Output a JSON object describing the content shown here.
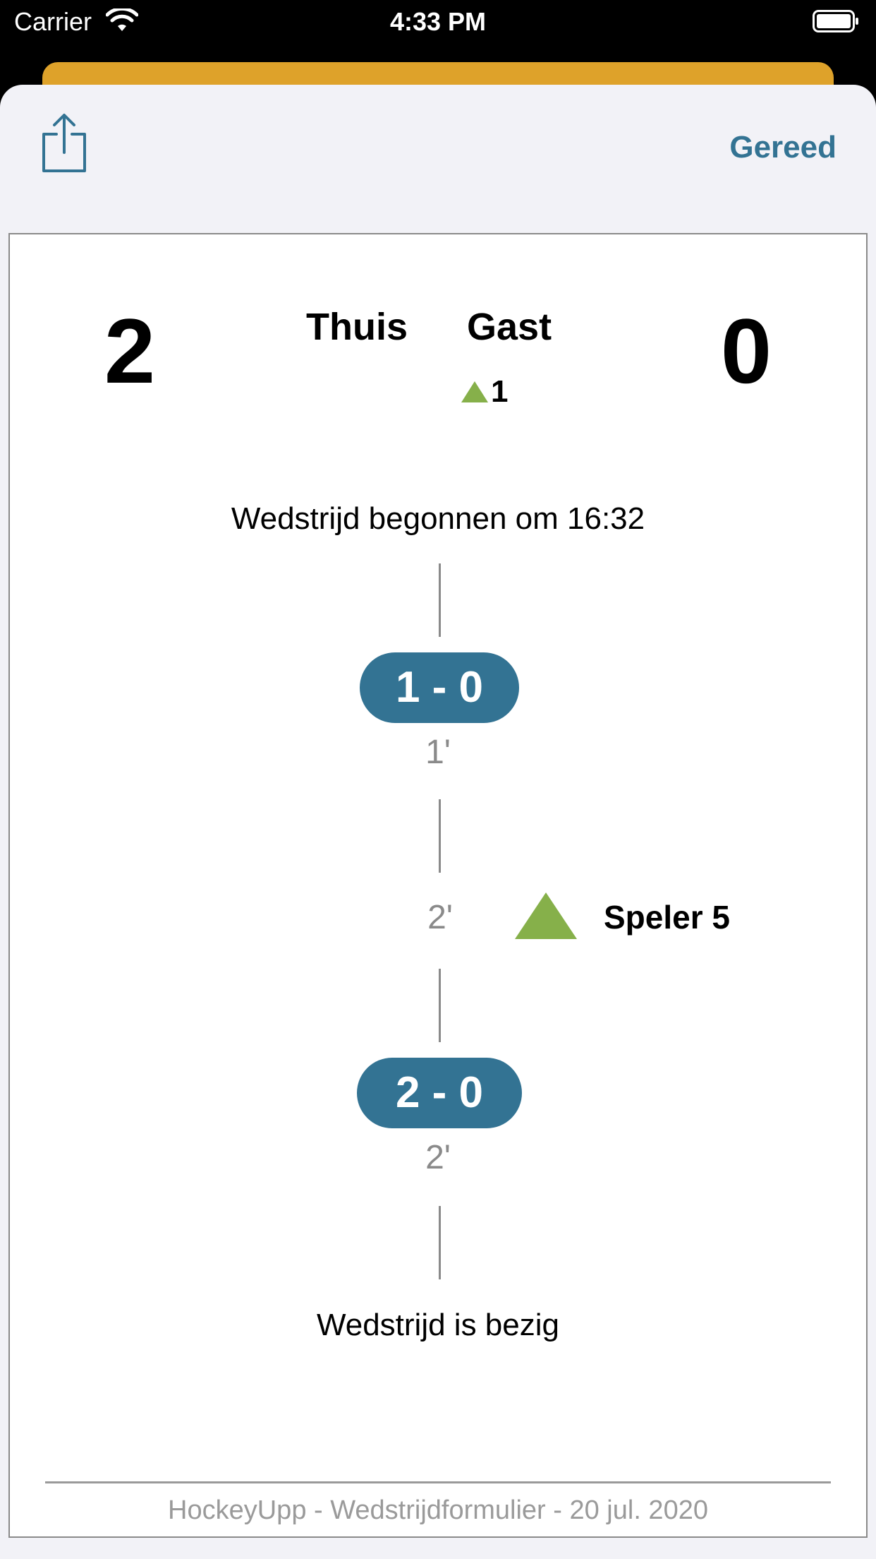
{
  "status_bar": {
    "carrier": "Carrier",
    "time": "4:33 PM"
  },
  "toolbar": {
    "done_label": "Gereed"
  },
  "scoreboard": {
    "home_score": "2",
    "away_score": "0",
    "home_label": "Thuis",
    "away_label": "Gast",
    "away_card_count": "1"
  },
  "timeline": {
    "start_text": "Wedstrijd begonnen om 16:32",
    "events": [
      {
        "type": "goal",
        "score": "1 - 0",
        "minute": "1'"
      },
      {
        "type": "card",
        "minute": "2'",
        "player": "Speler 5"
      },
      {
        "type": "goal",
        "score": "2 - 0",
        "minute": "2'"
      }
    ],
    "status_text": "Wedstrijd is bezig"
  },
  "footer": {
    "text": "HockeyUpp - Wedstrijdformulier - 20 jul. 2020"
  },
  "colors": {
    "accent": "#337393",
    "card_green": "#86b04a",
    "back_sheet": "#dea22a",
    "sheet_bg": "#f2f2f7"
  }
}
